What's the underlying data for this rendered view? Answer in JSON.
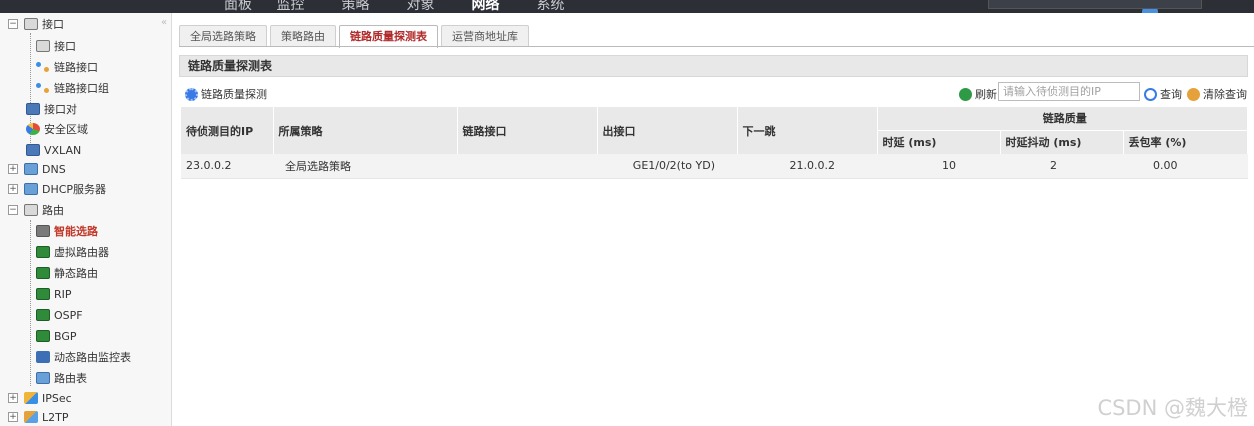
{
  "topnav": {
    "items": [
      "面板",
      "监控",
      "策略",
      "对象",
      "网络",
      "系统"
    ],
    "active_index": 4
  },
  "sidebar": {
    "items": [
      {
        "label": "接口",
        "icon": "interface-folder-icon",
        "expander": "−"
      },
      {
        "label": "接口",
        "icon": "interface-icon"
      },
      {
        "label": "链路接口",
        "icon": "link-interface-icon"
      },
      {
        "label": "链路接口组",
        "icon": "link-interface-group-icon"
      },
      {
        "label": "接口对",
        "icon": "interface-pair-icon"
      },
      {
        "label": "安全区域",
        "icon": "security-zone-icon"
      },
      {
        "label": "VXLAN",
        "icon": "vxlan-icon"
      },
      {
        "label": "DNS",
        "icon": "dns-icon",
        "expander": "+"
      },
      {
        "label": "DHCP服务器",
        "icon": "dhcp-icon",
        "expander": "+"
      },
      {
        "label": "路由",
        "icon": "routing-folder-icon",
        "expander": "−"
      },
      {
        "label": "智能选路",
        "icon": "smart-routing-icon"
      },
      {
        "label": "虚拟路由器",
        "icon": "virtual-router-icon"
      },
      {
        "label": "静态路由",
        "icon": "static-route-icon"
      },
      {
        "label": "RIP",
        "icon": "rip-icon"
      },
      {
        "label": "OSPF",
        "icon": "ospf-icon"
      },
      {
        "label": "BGP",
        "icon": "bgp-icon"
      },
      {
        "label": "动态路由监控表",
        "icon": "dynamic-route-monitor-icon"
      },
      {
        "label": "路由表",
        "icon": "route-table-icon"
      },
      {
        "label": "IPSec",
        "icon": "ipsec-icon",
        "expander": "+"
      },
      {
        "label": "L2TP",
        "icon": "l2tp-icon",
        "expander": "+"
      }
    ],
    "selected": "智能选路",
    "collapse_glyph": "«"
  },
  "tabs": [
    {
      "label": "全局选路策略"
    },
    {
      "label": "策略路由"
    },
    {
      "label": "链路质量探测表"
    },
    {
      "label": "运营商地址库"
    }
  ],
  "active_tab": "链路质量探测表",
  "panel_title": "链路质量探测表",
  "toolbar": {
    "probe_label": "链路质量探测",
    "refresh_label": "刷新",
    "ip_placeholder": "请输入待侦测目的IP",
    "query_label": "查询",
    "clear_label": "清除查询"
  },
  "table": {
    "headers": [
      "待侦测目的IP",
      "所属策略",
      "链路接口",
      "出接口",
      "下一跳"
    ],
    "group_header": "链路质量",
    "sub_headers": [
      "时延 (ms)",
      "时延抖动 (ms)",
      "丢包率 (%)"
    ],
    "rows": [
      {
        "dest_ip": "23.0.0.2",
        "policy": "全局选路策略",
        "link_if": "",
        "out_if": "GE1/0/2(to YD)",
        "next_hop": "21.0.0.2",
        "delay": "10",
        "jitter": "2",
        "loss": "0.00"
      }
    ]
  },
  "watermark": "CSDN @魏大橙",
  "colors": {
    "topbar_bg": "#2c2f36",
    "active_tab_text": "#b02a2a",
    "selected_item": "#c0392b",
    "header_bg": "#e9e9e9"
  }
}
